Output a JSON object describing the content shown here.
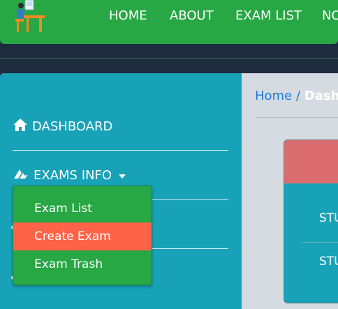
{
  "nav": {
    "items": [
      {
        "label": "HOME"
      },
      {
        "label": "ABOUT"
      },
      {
        "label": "EXAM LIST"
      },
      {
        "label": "NO"
      }
    ]
  },
  "sidebar": {
    "dashboard_label": "DASHBOARD",
    "exams_info_label": "EXAMS INFO",
    "dropdown": [
      {
        "label": "Exam List"
      },
      {
        "label": "Create Exam"
      },
      {
        "label": "Exam Trash"
      }
    ]
  },
  "breadcrumb": {
    "home": "Home",
    "separator": "/",
    "current": "Dash"
  },
  "card": {
    "rows": [
      {
        "label": "STU"
      },
      {
        "label": "STU"
      }
    ]
  },
  "colors": {
    "nav_green": "#28a745",
    "sidebar_teal": "#17a2b8",
    "active_item": "#ff6347",
    "card_header": "#dc6d6f"
  }
}
